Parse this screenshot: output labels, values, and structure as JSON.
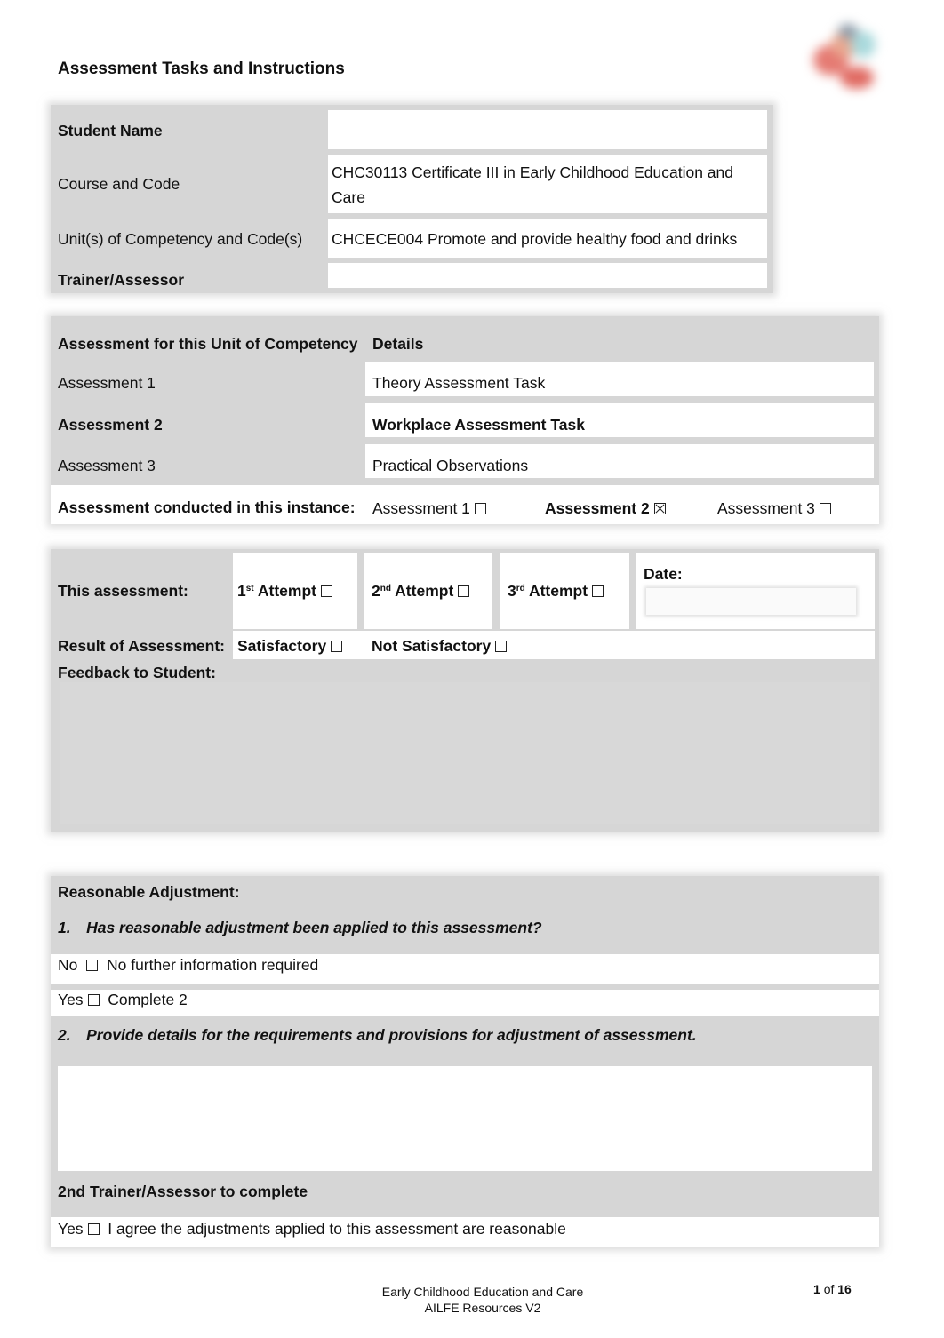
{
  "page": {
    "title": "Assessment Tasks and Instructions",
    "logo_icon": "institution-logo"
  },
  "info_table": {
    "rows": [
      {
        "label": "Student Name",
        "value": ""
      },
      {
        "label": "Course and Code",
        "value_line1": "CHC30113 Certificate III in Early Childhood Education and",
        "value_line2": "Care"
      },
      {
        "label": "Unit(s) of Competency and Code(s)",
        "value": "CHCECE004 Promote and provide healthy food and drinks"
      },
      {
        "label": "Trainer/Assessor",
        "value": ""
      }
    ]
  },
  "assessment_table": {
    "header_col1": "Assessment for this Unit of Competency",
    "header_col2": "Details",
    "rows": [
      {
        "label": "Assessment 1",
        "detail": "Theory Assessment Task"
      },
      {
        "label": "Assessment 2",
        "detail": "Workplace Assessment Task"
      },
      {
        "label": "Assessment 3",
        "detail": "Practical Observations"
      }
    ],
    "conducted_label": "Assessment conducted in this instance:",
    "conducted_options": [
      {
        "label": "Assessment 1",
        "checked": false
      },
      {
        "label": "Assessment 2",
        "checked": true
      },
      {
        "label": "Assessment 3",
        "checked": false
      }
    ]
  },
  "attempt_table": {
    "this_assessment_label": "This assessment:",
    "attempts": [
      {
        "num": "1",
        "sup": "st",
        "label": "Attempt",
        "checked": false
      },
      {
        "num": "2",
        "sup": "nd",
        "label": "Attempt",
        "checked": false
      },
      {
        "num": "3",
        "sup": "rd",
        "label": "Attempt",
        "checked": false
      }
    ],
    "date_label": "Date:",
    "date_value": "",
    "result_label": "Result of Assessment:",
    "result_options": [
      {
        "label": "Satisfactory",
        "checked": false
      },
      {
        "label": "Not Satisfactory",
        "checked": false
      }
    ],
    "feedback_label": "Feedback to Student:",
    "feedback_value": ""
  },
  "adjustment_table": {
    "title": "Reasonable Adjustment:",
    "q1": "1. Has reasonable adjustment been applied to this assessment?",
    "no_label": "No",
    "no_text": "No further information required",
    "no_checked": false,
    "yes_label": "Yes",
    "yes_text": "Complete 2",
    "yes_checked": false,
    "q2": "2. Provide details for the requirements and provisions for adjustment of assessment.",
    "details_value": "",
    "second_trainer_title": "2nd Trainer/Assessor to complete",
    "agree_label": "Yes",
    "agree_text": "I agree the adjustments applied to this assessment are reasonable",
    "agree_checked": false
  },
  "footer": {
    "line1": "Early Childhood Education and Care",
    "line2": "AILFE Resources V2",
    "page_current": "1",
    "page_of": "of",
    "page_total": "16"
  }
}
